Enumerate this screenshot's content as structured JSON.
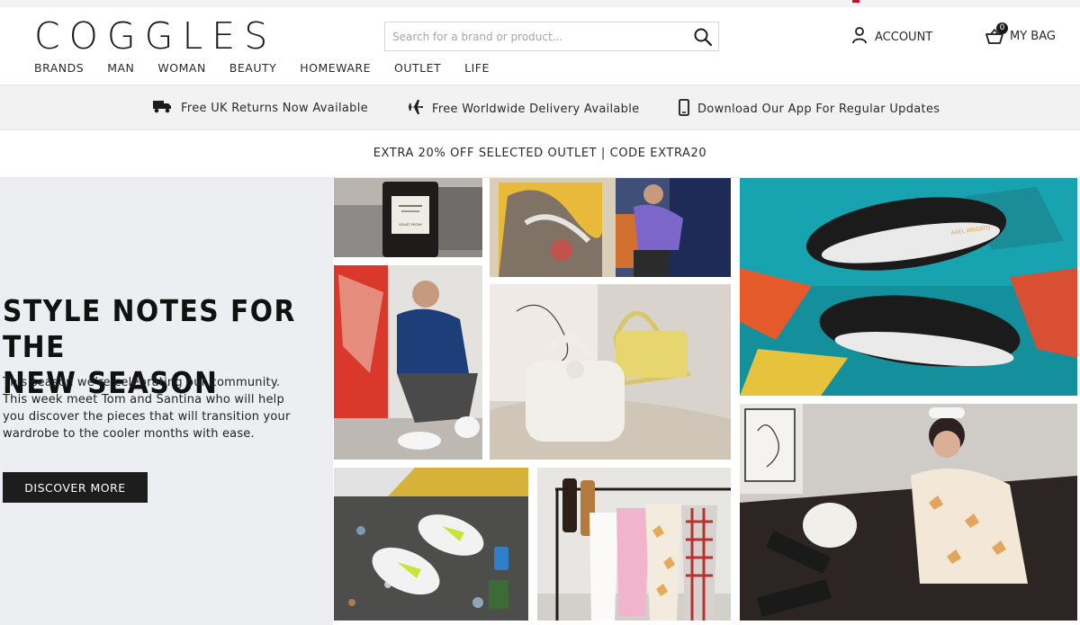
{
  "brand": {
    "logo": "COGGLES"
  },
  "search": {
    "placeholder": "Search for a brand or product..."
  },
  "header": {
    "account_label": "ACCOUNT",
    "bag_label": "MY BAG",
    "bag_count": "0"
  },
  "nav": {
    "items": [
      "BRANDS",
      "MAN",
      "WOMAN",
      "BEAUTY",
      "HOMEWARE",
      "OUTLET",
      "LIFE"
    ]
  },
  "benefits": [
    {
      "icon": "truck-icon",
      "text": "Free UK Returns Now Available"
    },
    {
      "icon": "plane-icon",
      "text": "Free Worldwide Delivery Available"
    },
    {
      "icon": "phone-icon",
      "text": "Download Our App For Regular Updates"
    }
  ],
  "promo": {
    "text": "EXTRA 20% OFF SELECTED OUTLET | CODE EXTRA20"
  },
  "hero": {
    "title_line1": "STYLE NOTES FOR THE",
    "title_line2": "NEW SEASON",
    "body_line1": "This season we’re celebrating our community.",
    "body_line2": "This week meet Tom and Santina who will help",
    "body_line3": "you discover the pieces that will transition your",
    "body_line4": "wardrobe to the cooler months with ease.",
    "cta": "DISCOVER MORE"
  },
  "images": {
    "candle_label_1": "VELVET PEONY",
    "sneaker_brand": "AXEL ARIGATO"
  },
  "colors": {
    "brand_dark": "#1a1a1a",
    "hero_bg": "#eceef1",
    "benefits_bg": "#f2f2f2"
  }
}
